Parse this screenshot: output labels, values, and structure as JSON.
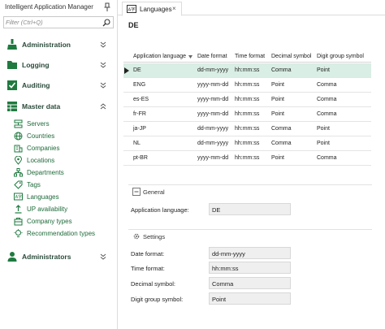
{
  "app": {
    "title": "Intelligent Application Manager"
  },
  "filter": {
    "placeholder": "Filter (Ctrl+Q)"
  },
  "nav": {
    "sections": [
      {
        "label": "Administration",
        "icon": "broom-icon"
      },
      {
        "label": "Logging",
        "icon": "folder-icon"
      },
      {
        "label": "Auditing",
        "icon": "checkbox-icon"
      },
      {
        "label": "Master data",
        "icon": "grid-icon",
        "expanded": true
      },
      {
        "label": "Administrators",
        "icon": "person-icon"
      }
    ],
    "master_items": [
      {
        "label": "Servers",
        "icon": "servers-icon"
      },
      {
        "label": "Countries",
        "icon": "globe-icon"
      },
      {
        "label": "Companies",
        "icon": "building-icon"
      },
      {
        "label": "Locations",
        "icon": "location-pin-icon"
      },
      {
        "label": "Departments",
        "icon": "departments-icon"
      },
      {
        "label": "Tags",
        "icon": "tag-icon"
      },
      {
        "label": "Languages",
        "icon": "language-icon",
        "active": true
      },
      {
        "label": "UP availability",
        "icon": "availability-icon"
      },
      {
        "label": "Company types",
        "icon": "company-type-icon"
      },
      {
        "label": "Recommendation types",
        "icon": "lightbulb-icon"
      }
    ]
  },
  "tab": {
    "label": "Languages",
    "close": "×"
  },
  "record": {
    "title": "DE"
  },
  "grid": {
    "columns": [
      "Application language",
      "Date format",
      "Time format",
      "Decimal symbol",
      "Digit group symbol"
    ],
    "rows": [
      [
        "DE",
        "dd-mm-yyyy",
        "hh:mm:ss",
        "Comma",
        "Point"
      ],
      [
        "ENG",
        "yyyy-mm-dd",
        "hh:mm:ss",
        "Point",
        "Comma"
      ],
      [
        "es-ES",
        "yyyy-mm-dd",
        "hh:mm:ss",
        "Point",
        "Comma"
      ],
      [
        "fr-FR",
        "yyyy-mm-dd",
        "hh:mm:ss",
        "Point",
        "Comma"
      ],
      [
        "ja-JP",
        "dd-mm-yyyy",
        "hh:mm:ss",
        "Comma",
        "Point"
      ],
      [
        "NL",
        "dd-mm-yyyy",
        "hh:mm:ss",
        "Comma",
        "Point"
      ],
      [
        "pt-BR",
        "yyyy-mm-dd",
        "hh:mm:ss",
        "Point",
        "Comma"
      ]
    ],
    "selected_index": 0
  },
  "general": {
    "title": "General",
    "fields": [
      {
        "label": "Application language:",
        "value": "DE"
      }
    ]
  },
  "settings": {
    "title": "Settings",
    "fields": [
      {
        "label": "Date format:",
        "value": "dd-mm-yyyy"
      },
      {
        "label": "Time format:",
        "value": "hh:mm:ss"
      },
      {
        "label": "Decimal symbol:",
        "value": "Comma"
      },
      {
        "label": "Digit group symbol:",
        "value": "Point"
      }
    ]
  },
  "colors": {
    "accent": "#1f7a3f",
    "selected_row": "#d9eee4",
    "nav_text": "#1f6b3a"
  }
}
